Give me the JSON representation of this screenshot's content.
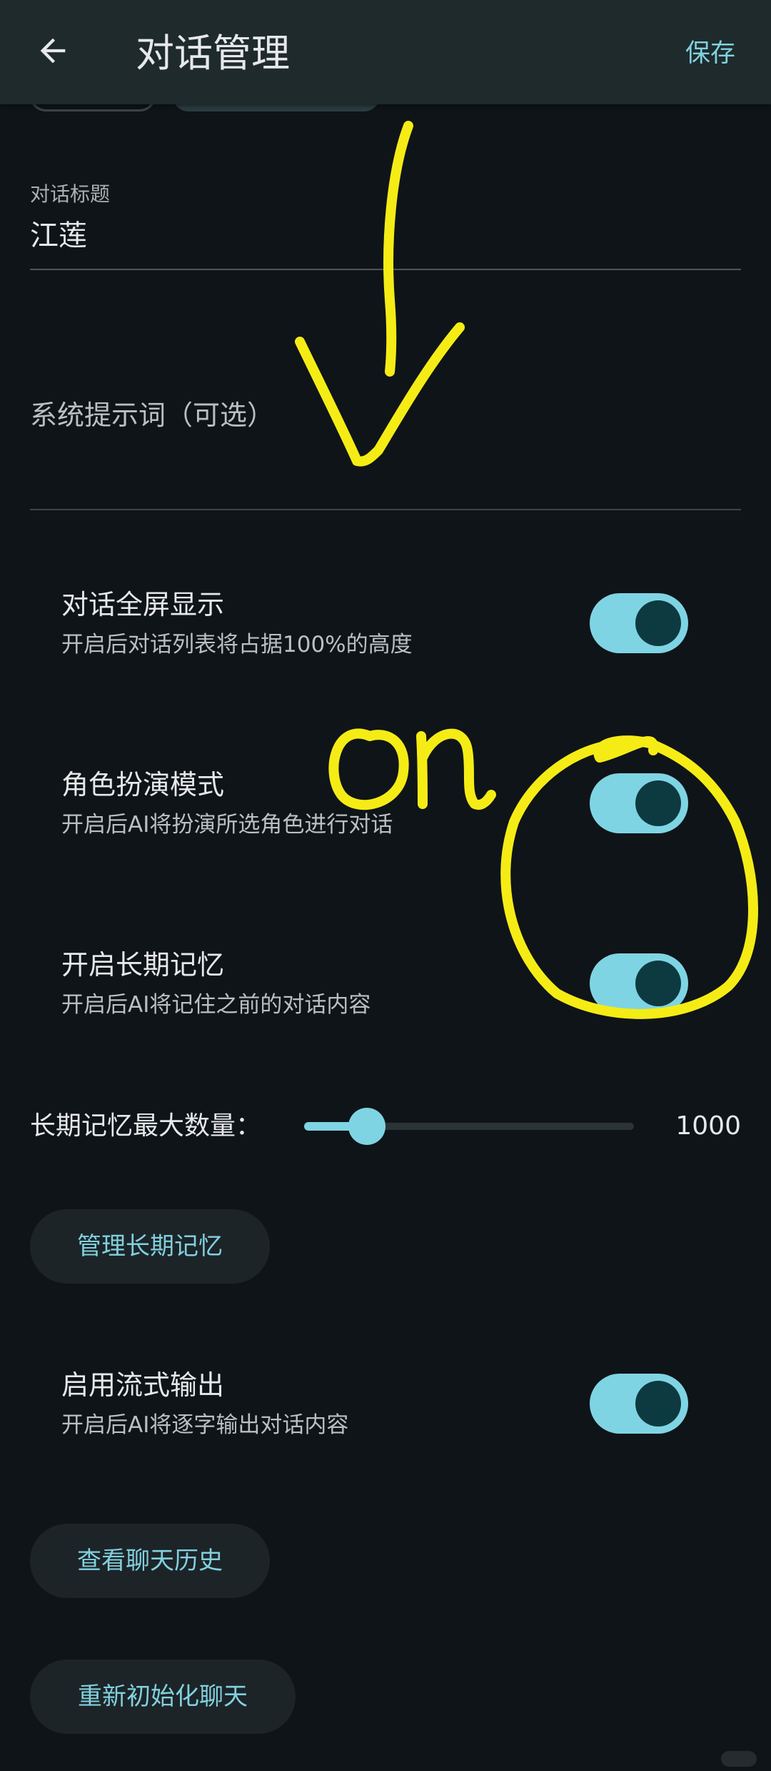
{
  "header": {
    "title": "对话管理",
    "save_label": "保存"
  },
  "title_field": {
    "label": "对话标题",
    "value": "江莲"
  },
  "system_prompt": {
    "placeholder": "系统提示词（可选）"
  },
  "settings": [
    {
      "title": "对话全屏显示",
      "subtitle": "开启后对话列表将占据100%的高度",
      "enabled": true
    },
    {
      "title": "角色扮演模式",
      "subtitle": "开启后AI将扮演所选角色进行对话",
      "enabled": true
    },
    {
      "title": "开启长期记忆",
      "subtitle": "开启后AI将记住之前的对话内容",
      "enabled": true
    }
  ],
  "memory_slider": {
    "label": "长期记忆最大数量：",
    "value_text": "1000",
    "fraction": 0.19
  },
  "buttons": {
    "manage_memory": "管理长期记忆",
    "view_history": "查看聊天历史",
    "reinit_chat": "重新初始化聊天"
  },
  "stream_setting": {
    "title": "启用流式输出",
    "subtitle": "开启后AI将逐字输出对话内容",
    "enabled": true
  },
  "annotation": {
    "text": "on",
    "color": "#f5ec16"
  },
  "colors": {
    "background": "#0f1418",
    "topbar": "#1f2a2c",
    "accent": "#7fd4e3",
    "switch_thumb": "#0d3a40"
  }
}
